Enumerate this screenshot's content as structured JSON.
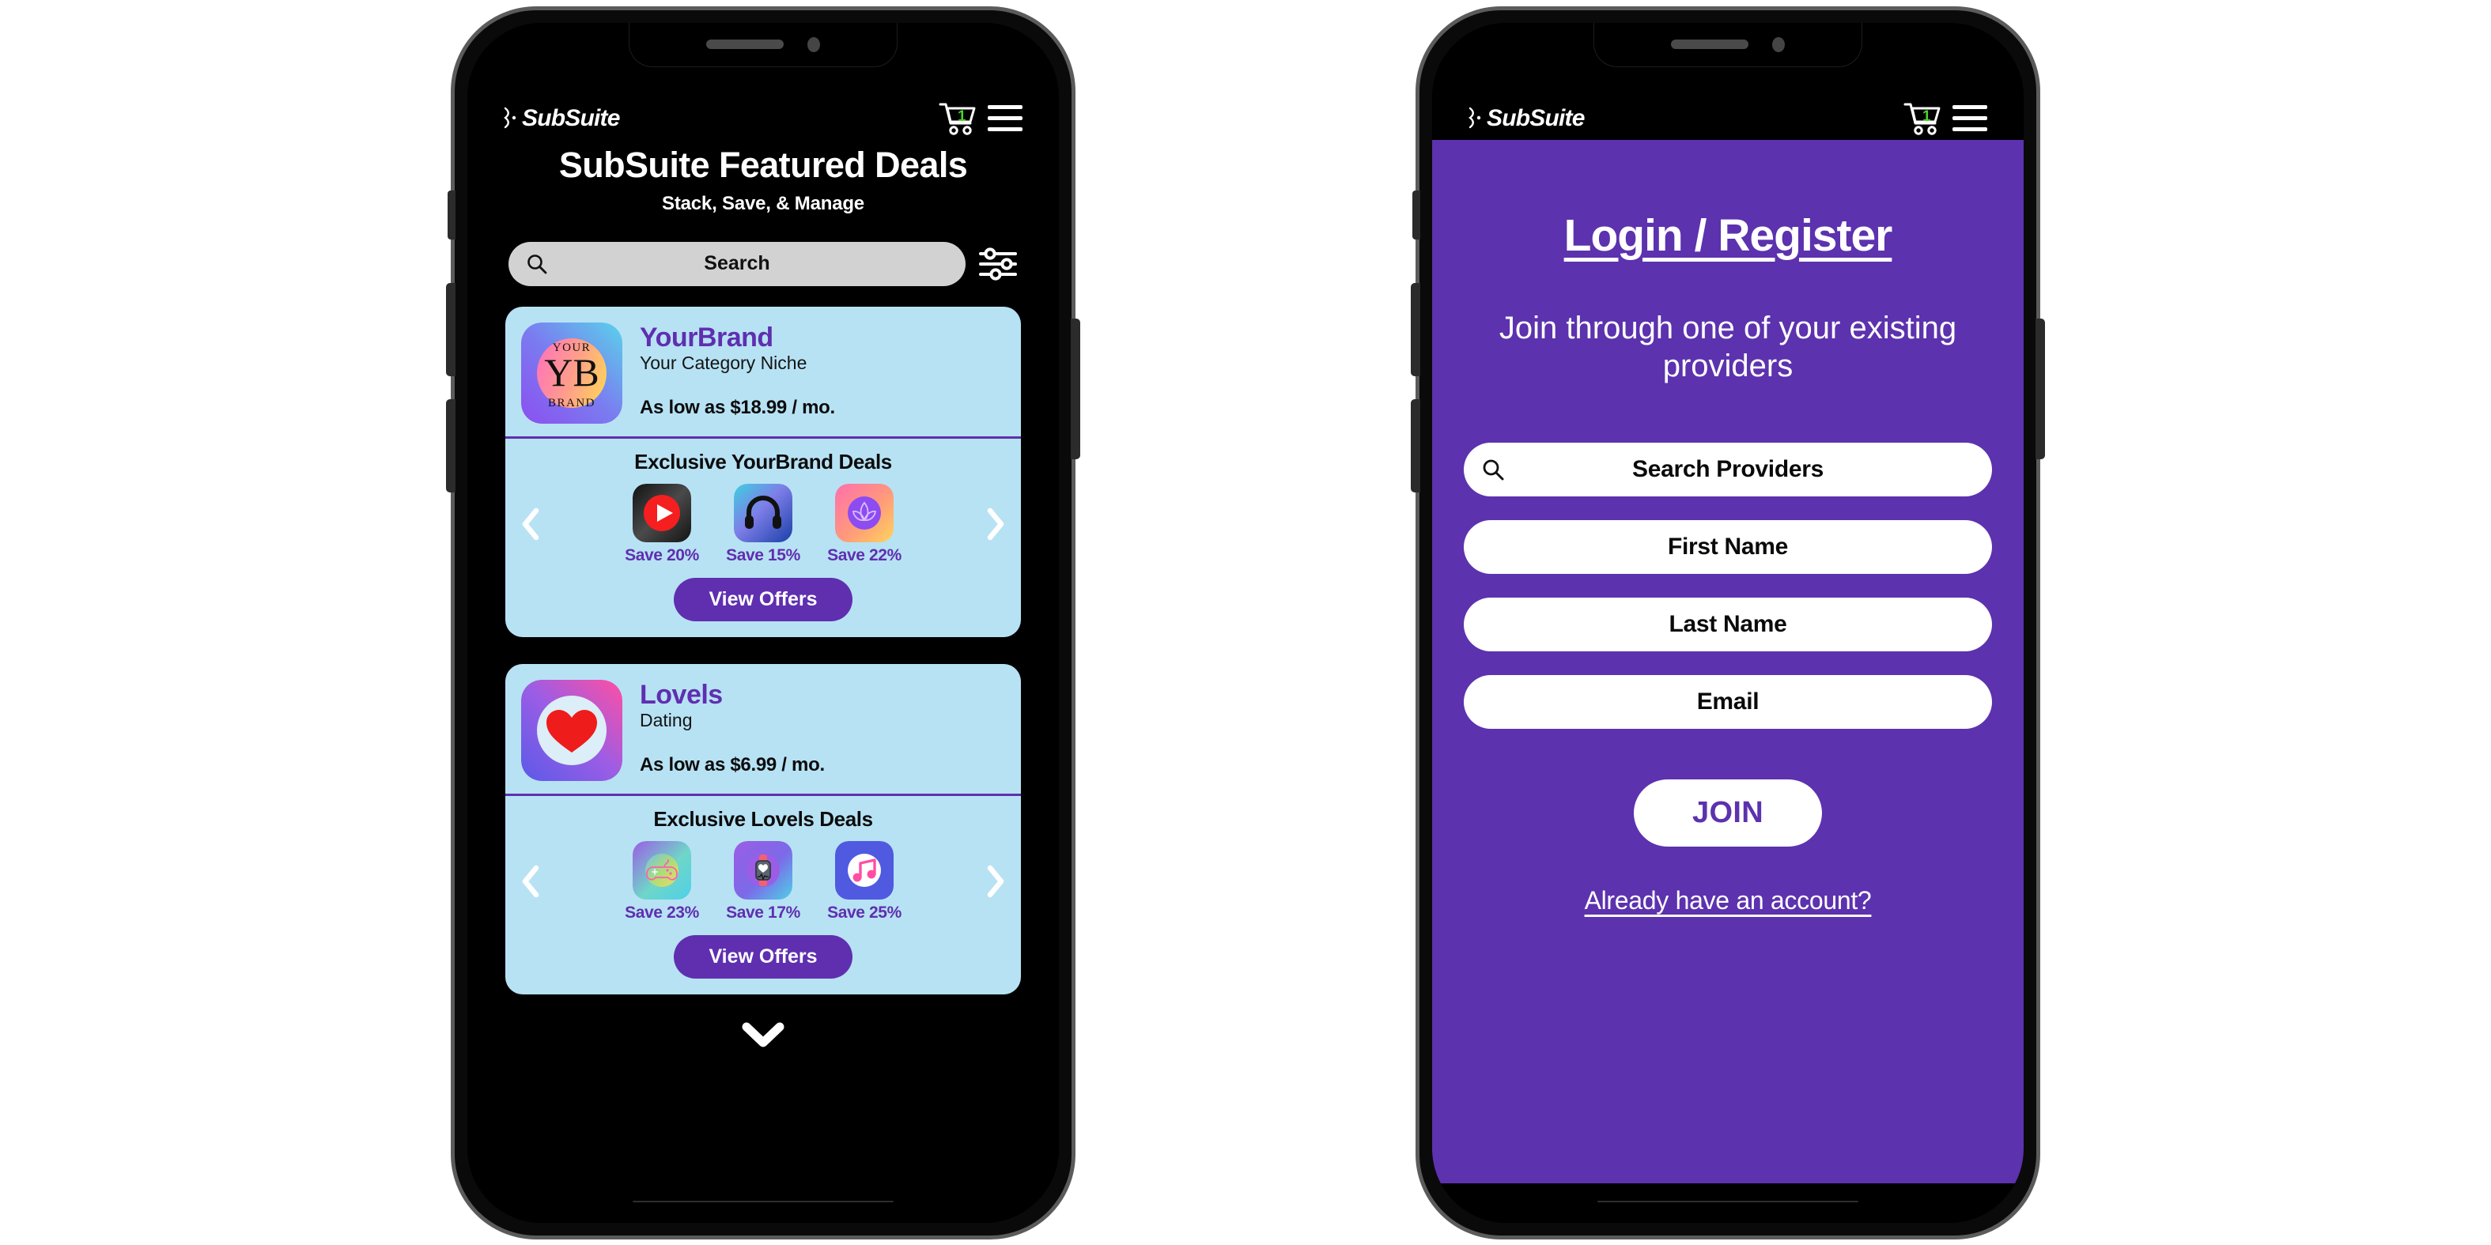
{
  "colors": {
    "brand_purple": "#5f2fb0",
    "login_purple": "#5c32ae",
    "card_blue": "#b7e2f4",
    "cart_badge_green": "#49d62a",
    "screen_black": "#000000"
  },
  "header": {
    "logo_text": "SubSuite",
    "logo_mark_icon": "subsuite-mark-icon",
    "cart_icon": "cart-icon",
    "cart_count": "1",
    "menu_icon": "hamburger-menu-icon"
  },
  "deals_screen": {
    "title": "SubSuite Featured Deals",
    "subtitle": "Stack, Save, & Manage",
    "search": {
      "label": "Search",
      "placeholder": "Search",
      "icon": "search-icon"
    },
    "filter_icon": "sliders-filter-icon",
    "scroll_down_icon": "chevron-down-icon",
    "cards": [
      {
        "app_icon": "yourbrand-logo-icon",
        "logo_lines": {
          "top": "YOUR",
          "middle": "YB",
          "bottom": "BRAND"
        },
        "name": "YourBrand",
        "category": "Your Category Niche",
        "price": "As low as $18.99 / mo.",
        "deals_heading": "Exclusive YourBrand Deals",
        "prev_icon": "chevron-left-icon",
        "next_icon": "chevron-right-icon",
        "cta_label": "View Offers",
        "deals": [
          {
            "icon": "play-video-icon",
            "save": "Save 20%"
          },
          {
            "icon": "headphones-audio-icon",
            "save": "Save 15%"
          },
          {
            "icon": "lotus-wellness-icon",
            "save": "Save 22%"
          }
        ]
      },
      {
        "app_icon": "lovels-heart-logo-icon",
        "name": "Lovels",
        "category": "Dating",
        "price": "As low as $6.99 / mo.",
        "deals_heading": "Exclusive Lovels Deals",
        "prev_icon": "chevron-left-icon",
        "next_icon": "chevron-right-icon",
        "cta_label": "View Offers",
        "deals": [
          {
            "icon": "gamepad-gaming-icon",
            "save": "Save 23%"
          },
          {
            "icon": "smartwatch-fitness-icon",
            "save": "Save 17%"
          },
          {
            "icon": "music-note-icon",
            "save": "Save 25%"
          }
        ]
      }
    ]
  },
  "login_screen": {
    "title": "Login / Register",
    "subtitle": "Join through one of your existing providers",
    "search_providers": {
      "label": "Search Providers",
      "placeholder": "Search Providers",
      "icon": "search-icon"
    },
    "fields": [
      {
        "label": "First Name",
        "placeholder": "First Name",
        "name": "first-name-field"
      },
      {
        "label": "Last Name",
        "placeholder": "Last Name",
        "name": "last-name-field"
      },
      {
        "label": "Email",
        "placeholder": "Email",
        "name": "email-field"
      }
    ],
    "join_label": "JOIN",
    "existing_account_link": "Already have an account?"
  }
}
